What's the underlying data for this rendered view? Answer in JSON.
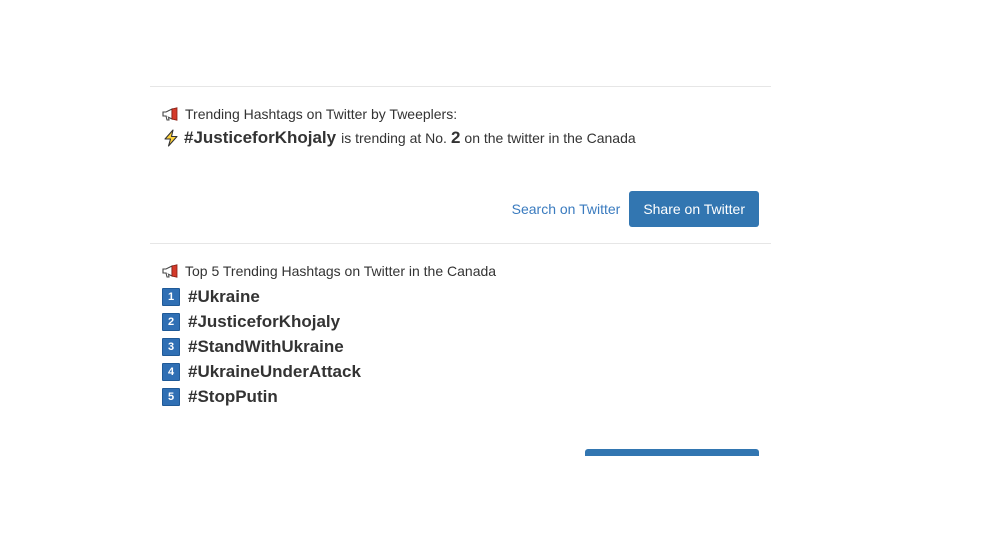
{
  "trending": {
    "header": "Trending Hashtags on Twitter by Tweeplers:",
    "hashtag": "#JusticeforKhojaly",
    "text_before_rank": "is trending at No.",
    "rank": "2",
    "text_after_rank": "on the twitter in the Canada"
  },
  "actions": {
    "search_label": "Search on Twitter",
    "share_label": "Share on Twitter"
  },
  "top5": {
    "header": "Top 5 Trending Hashtags on Twitter in the Canada",
    "items": [
      {
        "rank": "1",
        "tag": "#Ukraine"
      },
      {
        "rank": "2",
        "tag": "#JusticeforKhojaly"
      },
      {
        "rank": "3",
        "tag": "#StandWithUkraine"
      },
      {
        "rank": "4",
        "tag": "#UkraineUnderAttack"
      },
      {
        "rank": "5",
        "tag": "#StopPutin"
      }
    ]
  },
  "colors": {
    "accent": "#3276b1",
    "link": "#3a7bbf",
    "badge": "#2f6fb4"
  },
  "icons": {
    "megaphone": "megaphone-icon",
    "bolt": "lightning-icon"
  }
}
